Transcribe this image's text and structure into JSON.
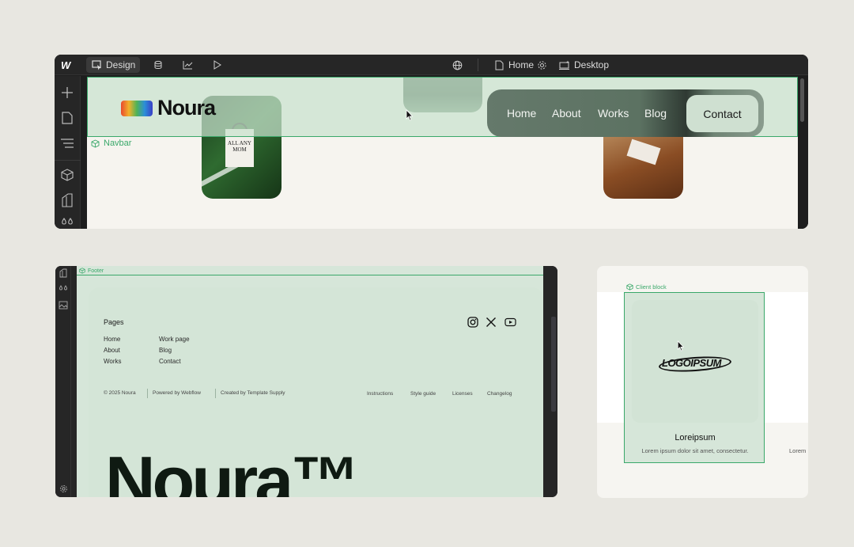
{
  "toolbar": {
    "design_label": "Design",
    "page_label": "Home",
    "breakpoint_label": "Desktop"
  },
  "navbar_component": {
    "selection_label": "Navbar",
    "brand_name": "Noura",
    "links": [
      "Home",
      "About",
      "Works",
      "Blog"
    ],
    "cta_label": "Contact",
    "bag_text": "ALL ANY MOM"
  },
  "footer_component": {
    "selection_label": "Footer",
    "pages_title": "Pages",
    "col1": [
      "Home",
      "About",
      "Works"
    ],
    "col2": [
      "Work page",
      "Blog",
      "Contact"
    ],
    "copyright": "© 2025 Noura",
    "powered_by": "Powered by Webflow",
    "created_by": "Created by Template Supply",
    "bottom_links": [
      "Instructions",
      "Style guide",
      "Licenses",
      "Changelog"
    ],
    "big_wordmark": "Noura™"
  },
  "client_component": {
    "selection_label": "Client block",
    "logo_text": "LOGOIPSUM",
    "name": "Loreipsum",
    "description": "Lorem ipsum dolor sit amet, consectetur.",
    "next_card_text": "Lorem"
  },
  "colors": {
    "selection_green": "#3aa86a",
    "editor_dark": "#1e1e1e",
    "mint_bg": "#d6e6d9",
    "page_bg": "#e8e7e1"
  },
  "icons": [
    "webflow-logo-icon",
    "design-cursor-icon",
    "cms-database-icon",
    "analytics-icon",
    "preview-play-icon",
    "globe-icon",
    "page-icon",
    "settings-gear-icon",
    "desktop-breakpoint-icon",
    "add-icon",
    "pages-icon",
    "navigator-icon",
    "components-icon",
    "style-manager-icon",
    "variables-icon",
    "instagram-icon",
    "x-twitter-icon",
    "youtube-icon"
  ]
}
